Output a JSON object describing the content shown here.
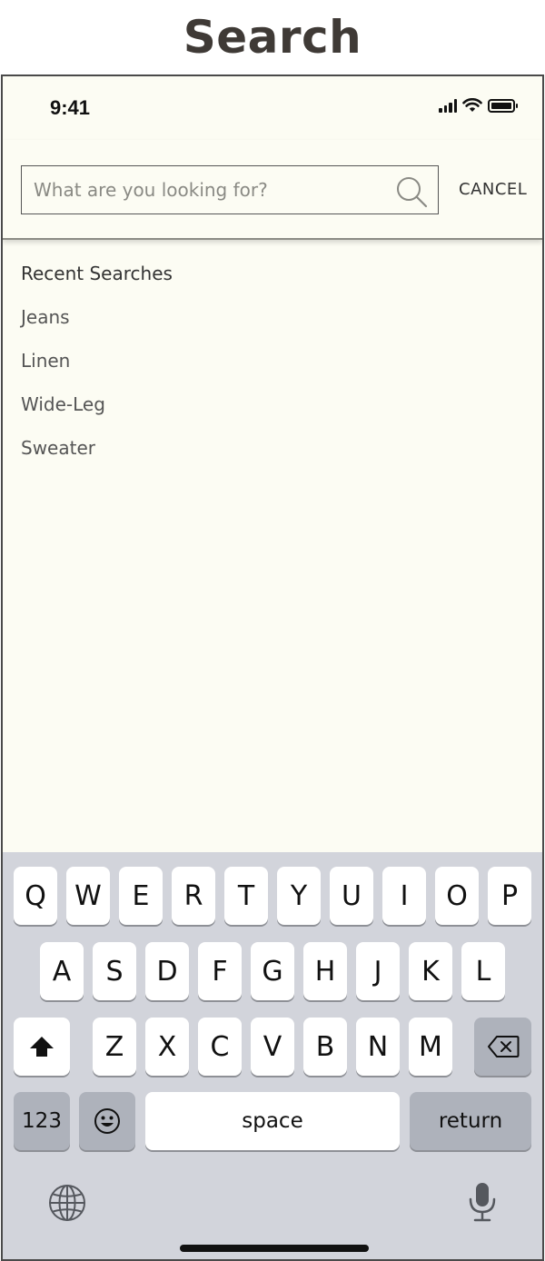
{
  "page": {
    "title": "Search"
  },
  "status_bar": {
    "time": "9:41"
  },
  "search": {
    "placeholder": "What are you looking for?",
    "value": "",
    "cancel_label": "CANCEL"
  },
  "recent": {
    "heading": "Recent Searches",
    "items": [
      "Jeans",
      "Linen",
      "Wide-Leg",
      "Sweater"
    ]
  },
  "keyboard": {
    "row1": [
      "Q",
      "W",
      "E",
      "R",
      "T",
      "Y",
      "U",
      "I",
      "O",
      "P"
    ],
    "row2": [
      "A",
      "S",
      "D",
      "F",
      "G",
      "H",
      "J",
      "K",
      "L"
    ],
    "row3": [
      "Z",
      "X",
      "C",
      "V",
      "B",
      "N",
      "M"
    ],
    "numbers_label": "123",
    "space_label": "space",
    "return_label": "return",
    "icons": {
      "shift": "shift-icon",
      "backspace": "backspace-icon",
      "emoji": "emoji-icon",
      "globe": "globe-icon",
      "mic": "microphone-icon"
    }
  },
  "colors": {
    "page_bg": "#fcfcf3",
    "keyboard_bg": "#d2d4db",
    "title": "#3f3a36"
  }
}
